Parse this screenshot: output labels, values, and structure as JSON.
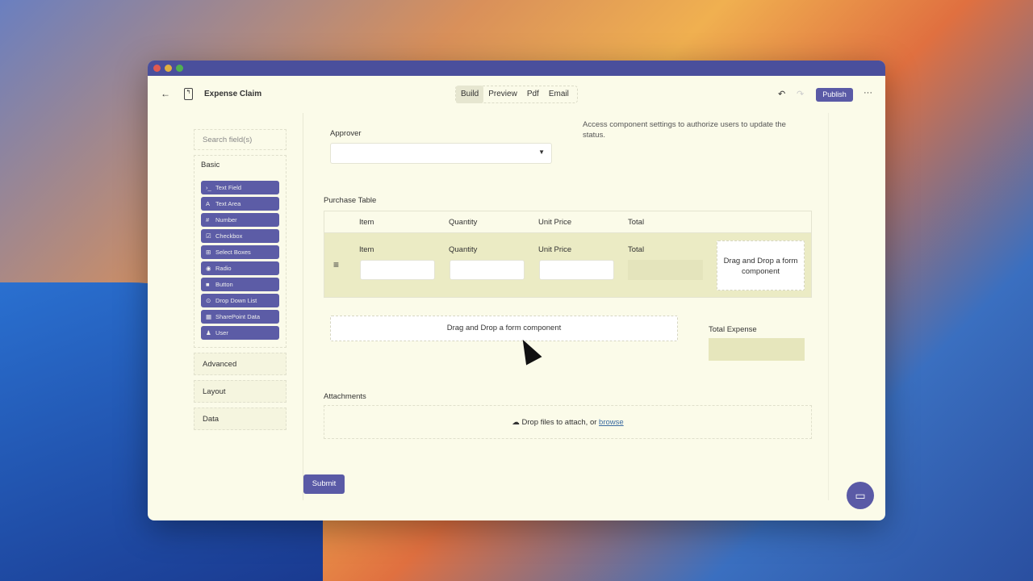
{
  "window": {
    "title": "Expense Claim",
    "tabs": [
      "Build",
      "Preview",
      "Pdf",
      "Email"
    ],
    "active_tab": "Build",
    "publish": "Publish",
    "more": "···"
  },
  "sidebar": {
    "search_placeholder": "Search field(s)",
    "basic": "Basic",
    "items": [
      {
        "icon": "›_",
        "label": "Text Field"
      },
      {
        "icon": "A",
        "label": "Text Area"
      },
      {
        "icon": "#",
        "label": "Number"
      },
      {
        "icon": "☑",
        "label": "Checkbox"
      },
      {
        "icon": "⊞",
        "label": "Select Boxes"
      },
      {
        "icon": "◉",
        "label": "Radio"
      },
      {
        "icon": "■",
        "label": "Button"
      },
      {
        "icon": "⊙",
        "label": "Drop Down List"
      },
      {
        "icon": "▦",
        "label": "SharePoint Data"
      },
      {
        "icon": "♟",
        "label": "User"
      }
    ],
    "groups": [
      "Advanced",
      "Layout",
      "Data"
    ]
  },
  "form": {
    "approver": "Approver",
    "note": "Access component settings to authorize users to update the status.",
    "purchase_table": "Purchase Table",
    "columns": [
      "Item",
      "Quantity",
      "Unit Price",
      "Total"
    ],
    "drop_small": "Drag and Drop a form component",
    "drop_wide": "Drag and Drop a form component",
    "total_expense": "Total Expense",
    "attachments": "Attachments",
    "drop_files": "Drop files to attach, or",
    "browse": "browse",
    "submit": "Submit"
  },
  "colors": {
    "accent": "#5a5aa6",
    "background": "#fbfbe9"
  }
}
